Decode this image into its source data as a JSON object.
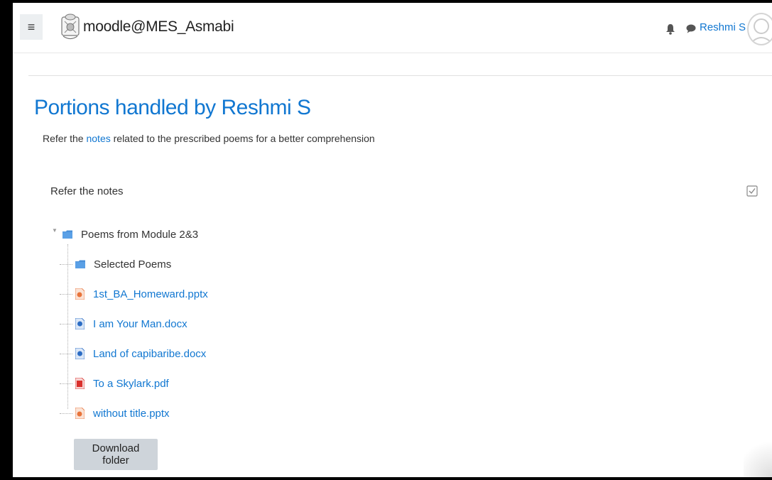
{
  "navbar": {
    "site_name": "moodle@MES_Asmabi",
    "user_name": "Reshmi S"
  },
  "page": {
    "title": "Portions handled by Reshmi S",
    "intro_before": "Refer the ",
    "intro_link": "notes",
    "intro_after": " related to the prescribed poems for a better comprehension",
    "section_label": "Refer the notes"
  },
  "folder": {
    "root_name": "Poems from Module 2&3",
    "items": [
      {
        "name": "Selected Poems",
        "type": "folder"
      },
      {
        "name": "1st_BA_Homeward.pptx",
        "type": "pptx"
      },
      {
        "name": "I am Your Man.docx",
        "type": "docx"
      },
      {
        "name": "Land of capibaribe.docx",
        "type": "docx"
      },
      {
        "name": "To a Skylark.pdf",
        "type": "pdf"
      },
      {
        "name": "without title.pptx",
        "type": "pptx"
      }
    ],
    "download_label": "Download folder"
  },
  "colors": {
    "link": "#1177d1",
    "folder": "#4a90d9",
    "pdf": "#d9302c",
    "pptx": "#e8743b",
    "docx": "#2b6cc4"
  }
}
